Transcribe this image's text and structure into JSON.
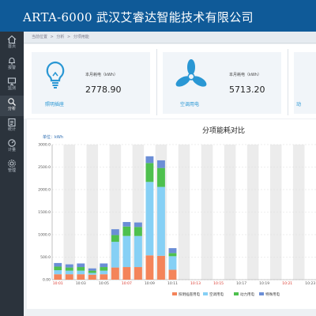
{
  "header": {
    "title": "ARTA-6000 武汉艾睿达智能技术有限公司"
  },
  "sidebar": {
    "items": [
      {
        "label": "首页",
        "icon": "home-icon",
        "active": false
      },
      {
        "label": "报警",
        "icon": "bell-icon",
        "active": false
      },
      {
        "label": "监测",
        "icon": "monitor-icon",
        "active": false
      },
      {
        "label": "分析",
        "icon": "analysis-icon",
        "active": true
      },
      {
        "label": "统计",
        "icon": "report-icon",
        "active": false
      },
      {
        "label": "计量",
        "icon": "meter-icon",
        "active": false
      },
      {
        "label": "管理",
        "icon": "settings-icon",
        "active": false
      }
    ]
  },
  "breadcrumb": {
    "items": [
      "当前位置",
      "分析",
      "分项用能"
    ],
    "separator": ">"
  },
  "cards": [
    {
      "name": "照明插座",
      "metric_label": "本月耗电（kWh）",
      "value": "2778.90",
      "icon": "lightbulb-icon"
    },
    {
      "name": "空调用电",
      "metric_label": "本月耗电（kWh）",
      "value": "5713.20",
      "icon": "fan-icon"
    },
    {
      "name": "动",
      "icon": "power-icon"
    }
  ],
  "colors": {
    "header_bg": "#0f5a98",
    "sidebar_bg": "#2b333c",
    "accent": "#2a97d4",
    "lighting": "#f4845a",
    "aircon": "#86d0f5",
    "power": "#4ec04e",
    "special": "#6b8ed6"
  },
  "chart_data": {
    "type": "bar",
    "stacked": true,
    "title": "分项能耗对比",
    "ylabel": "单位：kWh",
    "ylim": [
      0,
      3000
    ],
    "y_ticks": [
      "0.00",
      "500.0",
      "1000.0",
      "1500.0",
      "2000.0",
      "2500.0",
      "3000.0"
    ],
    "x_labels": [
      "10:01",
      "10:03",
      "10:05",
      "10:07",
      "10:09",
      "10:11",
      "10:13",
      "10:15",
      "10:17",
      "10:19",
      "10:21",
      "10:23"
    ],
    "x_label_colors": [
      "#d9362b",
      "#555555",
      "#555555",
      "#d9362b",
      "#555555",
      "#555555",
      "#d9362b",
      "#d9362b",
      "#555555",
      "#555555",
      "#d9362b",
      "#555555"
    ],
    "legend": [
      "照明插座用电",
      "空调用电",
      "动力用电",
      "特殊用电"
    ],
    "legend_position": "bottom",
    "series": [
      {
        "name": "照明插座用电",
        "color": "#f4845a",
        "values": [
          120,
          120,
          120,
          110,
          120,
          270,
          280,
          280,
          540,
          530,
          220,
          0,
          0,
          0,
          0,
          0,
          0,
          0,
          0,
          0,
          0,
          0,
          0
        ]
      },
      {
        "name": "空调用电",
        "color": "#86d0f5",
        "values": [
          90,
          80,
          80,
          40,
          80,
          570,
          690,
          690,
          1630,
          1530,
          300,
          0,
          0,
          0,
          0,
          0,
          0,
          0,
          0,
          0,
          0,
          0,
          0
        ]
      },
      {
        "name": "动力用电",
        "color": "#4ec04e",
        "values": [
          80,
          70,
          80,
          50,
          80,
          150,
          210,
          200,
          420,
          420,
          70,
          0,
          0,
          0,
          0,
          0,
          0,
          0,
          0,
          0,
          0,
          0,
          0
        ]
      },
      {
        "name": "特殊用电",
        "color": "#6b8ed6",
        "values": [
          80,
          70,
          80,
          50,
          80,
          130,
          100,
          100,
          150,
          170,
          110,
          0,
          0,
          0,
          0,
          0,
          0,
          0,
          0,
          0,
          0,
          0,
          0
        ]
      }
    ]
  }
}
